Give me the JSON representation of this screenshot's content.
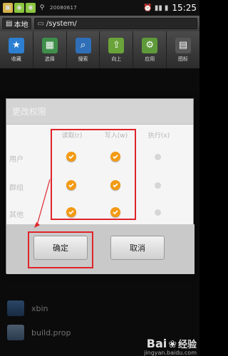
{
  "statusbar": {
    "icons": [
      "lock-icon",
      "android-icon",
      "android-icon",
      "usb-icon"
    ],
    "text": "20080617",
    "time": "15:25",
    "right_icons": [
      "alarm-icon",
      "signal-icon",
      "battery-icon"
    ]
  },
  "pathbar": {
    "location_label": "本地",
    "path": "/system/"
  },
  "toolbar": {
    "items": [
      {
        "label": "收藏",
        "icon": "star-icon",
        "color": "#2d7fd1"
      },
      {
        "label": "选择",
        "icon": "grid-select-icon",
        "color": "#3f8f4a"
      },
      {
        "label": "搜索",
        "icon": "search-icon",
        "color": "#2f6fb8"
      },
      {
        "label": "向上",
        "icon": "folder-up-icon",
        "color": "#6aa33a"
      },
      {
        "label": "应用",
        "icon": "app-icon",
        "color": "#5f9a3a"
      },
      {
        "label": "图标",
        "icon": "view-icon",
        "color": "#555555"
      }
    ]
  },
  "files": [
    {
      "name": "xbin"
    },
    {
      "name": "build.prop"
    }
  ],
  "dialog": {
    "title": "更改权限",
    "columns": [
      "读取(r)",
      "写入(w)",
      "执行(x)"
    ],
    "rows": [
      {
        "label": "用户",
        "read": true,
        "write": true,
        "exec": false
      },
      {
        "label": "群组",
        "read": true,
        "write": true,
        "exec": false
      },
      {
        "label": "其他",
        "read": true,
        "write": true,
        "exec": false
      }
    ],
    "ok_label": "确定",
    "cancel_label": "取消"
  },
  "colors": {
    "accent": "#f39a14",
    "highlight": "#e0232a"
  },
  "watermark": {
    "logo": "Bai",
    "logo2": "经验",
    "sub": "jingyan.baidu.com"
  }
}
